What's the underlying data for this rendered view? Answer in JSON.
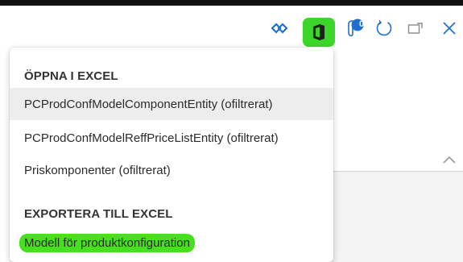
{
  "toolbar": {
    "icons": [
      "diamond-arrows-icon",
      "office-icon",
      "notification-badge-icon",
      "refresh-icon",
      "popout-icon",
      "close-icon"
    ],
    "badge_count": "0",
    "highlight_color": "#3cd62a"
  },
  "menu": {
    "section_open": {
      "header": "ÖPPNA I EXCEL",
      "items": [
        "PCProdConfModelComponentEntity (ofiltrerat)",
        "PCProdConfModelReffPriceListEntity (ofiltrerat)",
        "Priskomponenter (ofiltrerat)"
      ]
    },
    "section_export": {
      "header": "EXPORTERA TILL EXCEL",
      "items": [
        "Modell för produktkonfiguration"
      ]
    },
    "marker_color": "#47e01e",
    "hover_color": "#ededed"
  }
}
